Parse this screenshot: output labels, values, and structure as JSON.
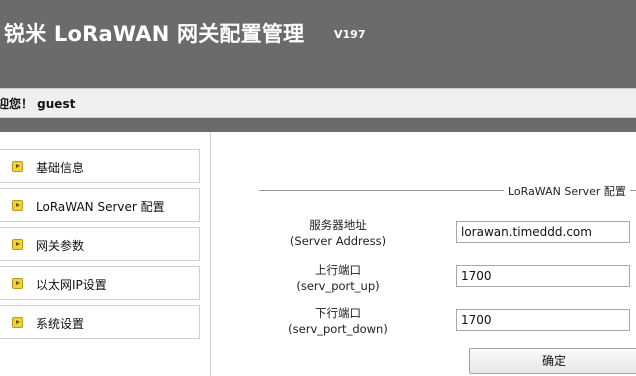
{
  "header": {
    "title": "锐米 LoRaWAN 网关配置管理",
    "version": "V197"
  },
  "welcome": {
    "text": "迎您！ guest"
  },
  "sidebar": {
    "items": [
      {
        "label": "基础信息",
        "icon": "arrow-right-icon"
      },
      {
        "label": "LoRaWAN Server 配置",
        "icon": "arrow-right-icon"
      },
      {
        "label": "网关参数",
        "icon": "arrow-right-icon"
      },
      {
        "label": "以太网IP设置",
        "icon": "arrow-right-icon"
      },
      {
        "label": "系统设置",
        "icon": "arrow-right-icon"
      }
    ]
  },
  "form": {
    "legend": "LoRaWAN Server 配置",
    "fields": [
      {
        "label_cn": "服务器地址",
        "label_en": "(Server Address)",
        "value": "lorawan.timeddd.com"
      },
      {
        "label_cn": "上行端口",
        "label_en": "(serv_port_up)",
        "value": "1700"
      },
      {
        "label_cn": "下行端口",
        "label_en": "(serv_port_down)",
        "value": "1700"
      }
    ],
    "submit_label": "确定"
  },
  "colors": {
    "header_bg": "#6b6b6b",
    "icon_yellow": "#f2d23a"
  }
}
